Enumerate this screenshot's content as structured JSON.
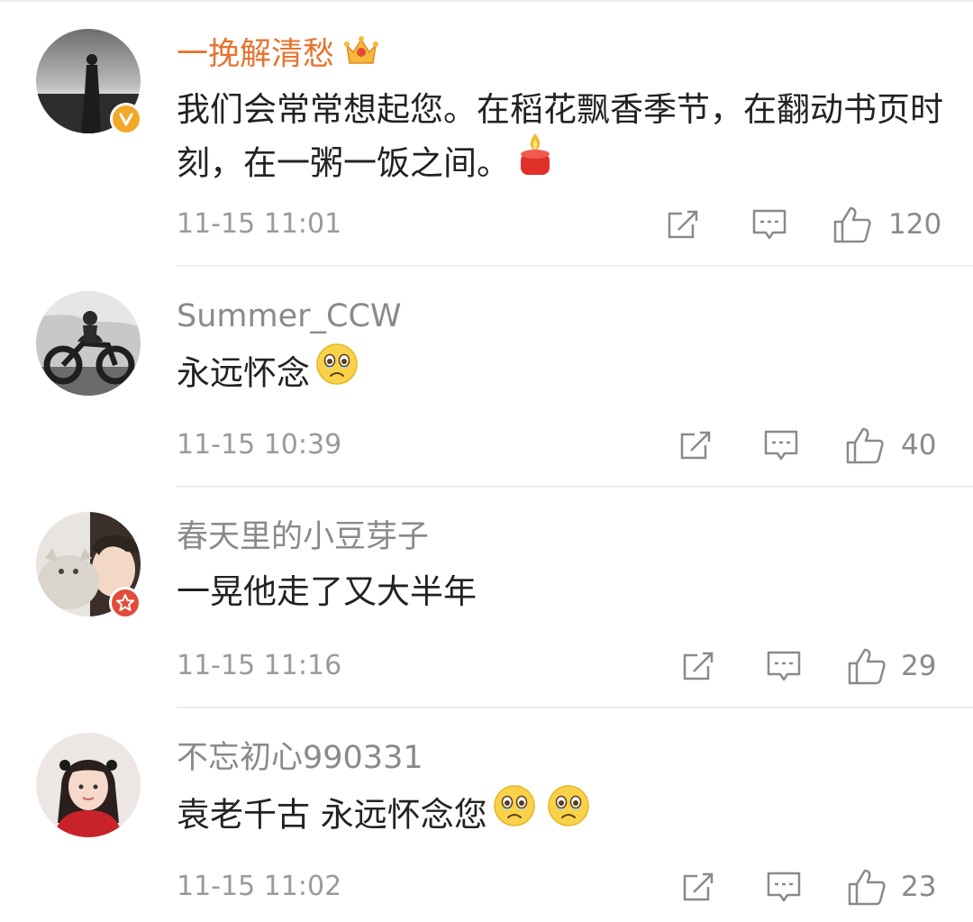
{
  "comments": [
    {
      "name": "一挽解清愁",
      "text": "我们会常常想起您。在稻花飘香季节，在翻动书页时刻，在一粥一饭之间。",
      "time": "11-15 11:01",
      "likes": "120",
      "avatar_icon": "silhouette-avatar",
      "badge": "verified-v-badge",
      "name_icon": "crown-icon",
      "emoji": [
        "candle-emoji"
      ]
    },
    {
      "name": "Summer_CCW",
      "text": "永远怀念",
      "time": "11-15 10:39",
      "likes": "40",
      "avatar_icon": "motorcycle-avatar",
      "emoji": [
        "crying-face-emoji"
      ]
    },
    {
      "name": "春天里的小豆芽子",
      "text": "一晃他走了又大半年",
      "time": "11-15 11:16",
      "likes": "29",
      "avatar_icon": "girl-with-cat-avatar",
      "badge": "star-badge"
    },
    {
      "name": "不忘初心990331",
      "text": "袁老千古 永远怀念您",
      "time": "11-15 11:02",
      "likes": "23",
      "avatar_icon": "girl-portrait-avatar",
      "emoji": [
        "crying-face-emoji",
        "crying-face-emoji"
      ]
    }
  ],
  "colors": {
    "vip_name": "#e8742f",
    "name": "#8a8a8a",
    "text": "#222222",
    "meta": "#9a9a9a",
    "verified_badge": "#f2a92a",
    "star_badge": "#e24b3b"
  },
  "actions": [
    "share-icon",
    "comment-icon",
    "like-icon"
  ]
}
